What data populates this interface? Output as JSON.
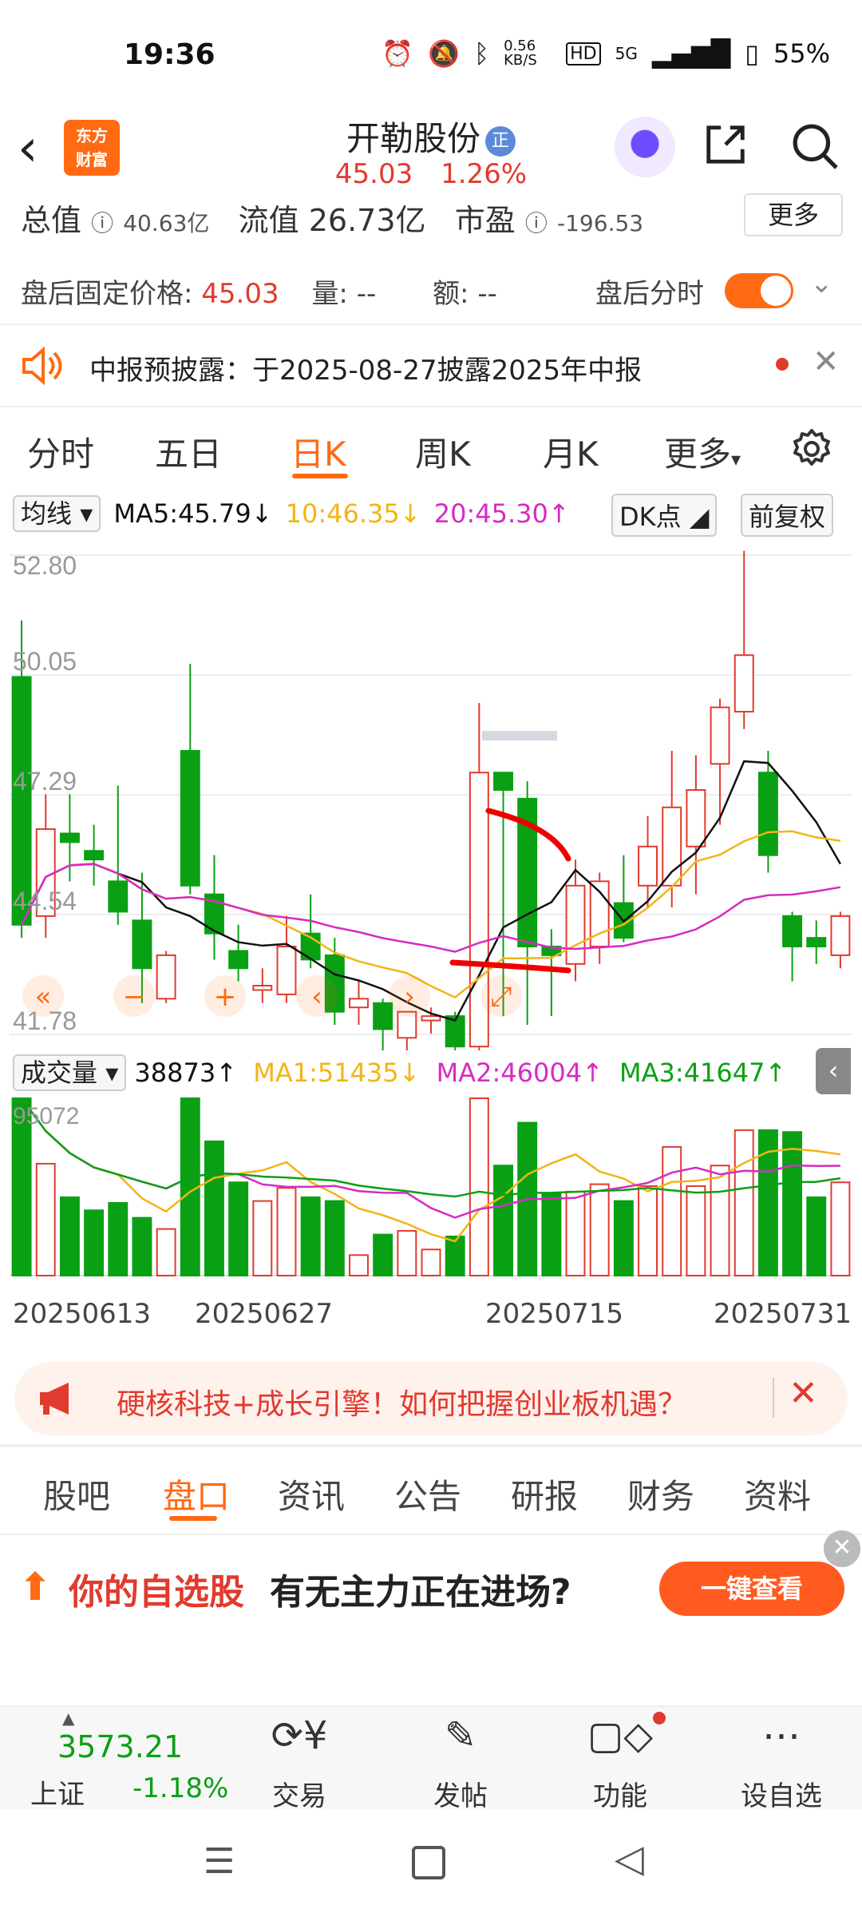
{
  "status": {
    "time": "19:36",
    "speed": "0.56 KB/S",
    "network": "5G",
    "battery": "55%"
  },
  "header": {
    "logo_line1": "东方",
    "logo_line2": "财富",
    "title": "开勒股份",
    "title_badge": "正",
    "price": "45.03",
    "change": "1.26%"
  },
  "info": {
    "total_value_label": "总值",
    "total_value": "40.63亿",
    "float_label": "流值",
    "float_value": "26.73亿",
    "pe_label": "市盈",
    "pe_value": "-196.53",
    "more": "更多",
    "after_price_label": "盘后固定价格:",
    "after_price": "45.03",
    "vol_label": "量: --",
    "amt_label": "额: --",
    "after_chart_label": "盘后分时"
  },
  "notice": {
    "text": "中报预披露：于2025-08-27披露2025年中报"
  },
  "ktabs": [
    "分时",
    "五日",
    "日K",
    "周K",
    "月K",
    "更多"
  ],
  "ktab_active": "日K",
  "ma": {
    "selector": "均线",
    "ma5": "MA5:45.79",
    "ma10": "10:46.35",
    "ma20": "20:45.30",
    "dk": "DK点",
    "fq": "前复权"
  },
  "vol": {
    "selector": "成交量",
    "vol": "38873",
    "ma1": "MA1:51435",
    "ma2": "MA2:46004",
    "ma3": "MA3:41647",
    "max_label": "95072"
  },
  "colors": {
    "up": "#e23a2e",
    "down": "#0aa014",
    "ma5": "#111111",
    "ma10": "#f2b416",
    "ma20": "#d62bc4",
    "accent": "#ff6a13"
  },
  "chart_data": {
    "type": "candlestick",
    "y_ticks": [
      "52.80",
      "50.05",
      "47.29",
      "44.54",
      "41.78"
    ],
    "ylim": [
      41.78,
      52.8
    ],
    "dates": [
      "20250613",
      "20250627",
      "20250715",
      "20250731"
    ],
    "candles": [
      {
        "o": 50.0,
        "h": 51.3,
        "l": 44.0,
        "c": 44.3
      },
      {
        "o": 44.5,
        "h": 47.3,
        "l": 44.0,
        "c": 46.5
      },
      {
        "o": 46.4,
        "h": 47.3,
        "l": 45.3,
        "c": 46.2
      },
      {
        "o": 46.0,
        "h": 46.6,
        "l": 45.2,
        "c": 45.8
      },
      {
        "o": 45.3,
        "h": 47.5,
        "l": 44.3,
        "c": 44.6
      },
      {
        "o": 44.4,
        "h": 45.5,
        "l": 42.5,
        "c": 43.3
      },
      {
        "o": 42.6,
        "h": 43.7,
        "l": 42.5,
        "c": 43.6
      },
      {
        "o": 48.3,
        "h": 50.3,
        "l": 45.0,
        "c": 45.2
      },
      {
        "o": 45.0,
        "h": 45.9,
        "l": 43.5,
        "c": 44.1
      },
      {
        "o": 43.7,
        "h": 44.3,
        "l": 43.0,
        "c": 43.3
      },
      {
        "o": 42.8,
        "h": 43.3,
        "l": 42.5,
        "c": 42.9
      },
      {
        "o": 42.7,
        "h": 44.5,
        "l": 42.5,
        "c": 43.8
      },
      {
        "o": 44.1,
        "h": 45.0,
        "l": 43.3,
        "c": 43.5
      },
      {
        "o": 43.6,
        "h": 44.0,
        "l": 42.0,
        "c": 42.3
      },
      {
        "o": 42.4,
        "h": 43.0,
        "l": 42.0,
        "c": 42.6
      },
      {
        "o": 42.5,
        "h": 42.6,
        "l": 41.3,
        "c": 41.9
      },
      {
        "o": 41.7,
        "h": 42.3,
        "l": 41.3,
        "c": 42.3
      },
      {
        "o": 42.1,
        "h": 42.4,
        "l": 41.8,
        "c": 42.2
      },
      {
        "o": 42.2,
        "h": 42.3,
        "l": 41.4,
        "c": 41.5
      },
      {
        "o": 41.5,
        "h": 49.4,
        "l": 41.3,
        "c": 47.8
      },
      {
        "o": 47.8,
        "h": 47.8,
        "l": 42.2,
        "c": 47.4
      },
      {
        "o": 47.2,
        "h": 47.6,
        "l": 42.0,
        "c": 43.8
      },
      {
        "o": 43.8,
        "h": 44.2,
        "l": 42.2,
        "c": 43.6
      },
      {
        "o": 43.4,
        "h": 45.8,
        "l": 43.0,
        "c": 45.2
      },
      {
        "o": 43.8,
        "h": 45.5,
        "l": 43.4,
        "c": 45.3
      },
      {
        "o": 44.8,
        "h": 45.9,
        "l": 43.9,
        "c": 44.0
      },
      {
        "o": 45.2,
        "h": 46.8,
        "l": 44.7,
        "c": 46.1
      },
      {
        "o": 45.2,
        "h": 48.3,
        "l": 44.7,
        "c": 47.0
      },
      {
        "o": 46.1,
        "h": 48.2,
        "l": 45.0,
        "c": 47.4
      },
      {
        "o": 48.0,
        "h": 49.5,
        "l": 46.6,
        "c": 49.3
      },
      {
        "o": 49.2,
        "h": 52.9,
        "l": 48.8,
        "c": 50.5
      },
      {
        "o": 47.8,
        "h": 48.3,
        "l": 45.5,
        "c": 45.9
      },
      {
        "o": 44.5,
        "h": 44.6,
        "l": 43.0,
        "c": 43.8
      },
      {
        "o": 44.0,
        "h": 44.4,
        "l": 43.4,
        "c": 43.8
      },
      {
        "o": 43.6,
        "h": 44.6,
        "l": 43.3,
        "c": 44.5
      }
    ],
    "volumes": [
      95072,
      60000,
      42000,
      35000,
      39000,
      31000,
      25000,
      95072,
      72000,
      50000,
      40000,
      47000,
      42000,
      40000,
      11000,
      22000,
      24000,
      14000,
      21000,
      95072,
      59000,
      82000,
      44000,
      45000,
      49000,
      40000,
      48000,
      69000,
      48000,
      59000,
      78000,
      78000,
      77000,
      42000,
      50000
    ]
  },
  "promo": {
    "text": "硬核科技+成长引擎！如何把握创业板机遇？"
  },
  "stabs": [
    "股吧",
    "盘口",
    "资讯",
    "公告",
    "研报",
    "财务",
    "资料"
  ],
  "stab_active": "盘口",
  "ad": {
    "text1": "你的自选股",
    "text2": "有无主力正在进场?",
    "button": "一键查看"
  },
  "bottom": {
    "index_value": "3573.21",
    "index_name": "上证",
    "index_change": "-1.18%",
    "trade": "交易",
    "post": "发帖",
    "func": "功能",
    "watch": "设自选"
  }
}
